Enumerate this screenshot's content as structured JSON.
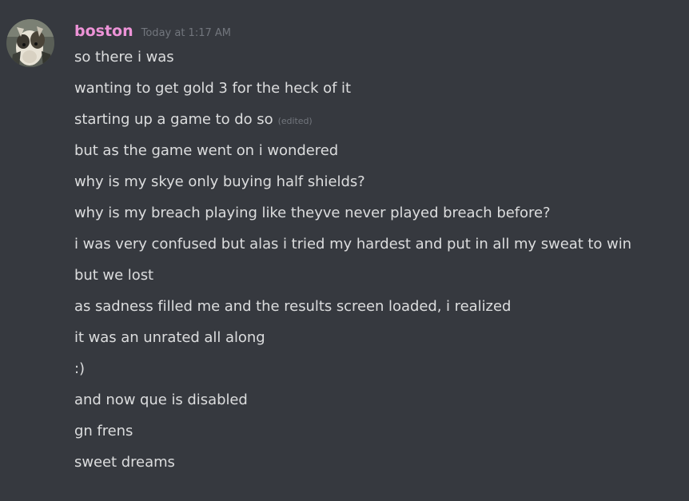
{
  "author": {
    "name": "boston",
    "timestamp": "Today at 1:17 AM",
    "name_color": "#ed93d7",
    "avatar": "llama-avatar"
  },
  "edited_label": "(edited)",
  "messages": [
    {
      "text": "so there i was"
    },
    {
      "text": "wanting to get gold 3 for the heck of it"
    },
    {
      "text": "starting up a game to do so",
      "edited": true
    },
    {
      "text": "but as the game went on i wondered"
    },
    {
      "text": "why is my skye only buying half shields?"
    },
    {
      "text": "why is my breach playing like theyve never played breach before?"
    },
    {
      "text": "i was very confused but alas i tried my hardest and put in all my sweat to win"
    },
    {
      "text": "but we lost"
    },
    {
      "text": "as sadness filled me and the results screen loaded, i realized"
    },
    {
      "text": "it was an unrated all along"
    },
    {
      "text": ":)"
    },
    {
      "text": "and now que is disabled"
    },
    {
      "text": "gn frens"
    },
    {
      "text": "sweet dreams"
    }
  ],
  "colors": {
    "background": "#36393f",
    "text": "#dcddde",
    "muted": "#72767d"
  }
}
